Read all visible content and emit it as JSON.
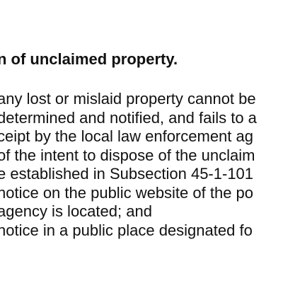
{
  "document": {
    "heading": "n of unclaimed property.",
    "lines": [
      "any lost or mislaid property cannot be",
      "determined and notified, and fails to a",
      "ceipt by the local law enforcement ag",
      "of the intent to dispose of the unclaim",
      "e established in Subsection 45-1-101",
      "notice on the public website of the po",
      "agency is located; and",
      "notice in a public place designated fo"
    ]
  }
}
